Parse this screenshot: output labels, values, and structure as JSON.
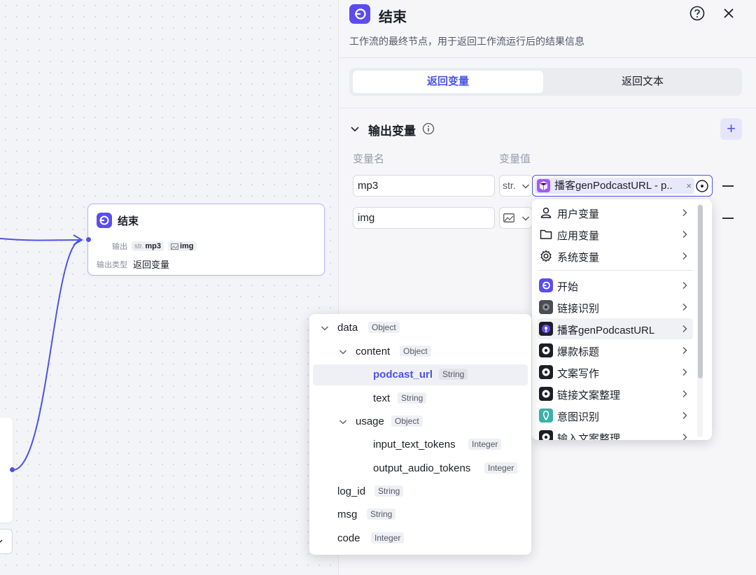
{
  "canvas": {
    "end_node": {
      "title": "结束",
      "output_label": "输出",
      "output_chips": [
        {
          "type": "str.",
          "name": "mp3"
        },
        {
          "type": "",
          "name": "img"
        }
      ],
      "output_type_label": "输出类型",
      "output_type_value": "返回变量"
    }
  },
  "panel": {
    "title": "结束",
    "description": "工作流的最终节点，用于返回工作流运行后的结果信息",
    "tabs": [
      "返回变量",
      "返回文本"
    ],
    "section_title": "输出变量",
    "add_label": "+",
    "col_name": "变量名",
    "col_value": "变量值",
    "rows": [
      {
        "name": "mp3",
        "type": "str.",
        "value": "播客genPodcastURL - p..",
        "value_clear": "×"
      },
      {
        "name": "img",
        "type": ""
      }
    ]
  },
  "menu": {
    "groups": [
      "用户变量",
      "应用变量",
      "系统变量"
    ],
    "nodes": [
      "开始",
      "链接识别",
      "播客genPodcastURL",
      "爆款标题",
      "文案写作",
      "链接文案整理",
      "意图识别",
      "输入文案整理"
    ]
  },
  "tree": {
    "rows": [
      {
        "key": "data",
        "type": "Object"
      },
      {
        "key": "content",
        "type": "Object"
      },
      {
        "key": "podcast_url",
        "type": "String"
      },
      {
        "key": "text",
        "type": "String"
      },
      {
        "key": "usage",
        "type": "Object"
      },
      {
        "key": "input_text_tokens",
        "type": "Integer"
      },
      {
        "key": "output_audio_tokens",
        "type": "Integer"
      },
      {
        "key": "log_id",
        "type": "String"
      },
      {
        "key": "msg",
        "type": "String"
      },
      {
        "key": "code",
        "type": "Integer"
      }
    ]
  },
  "colors": {
    "accent": "#4d53e8",
    "node_icon": "#5b4cf0"
  }
}
